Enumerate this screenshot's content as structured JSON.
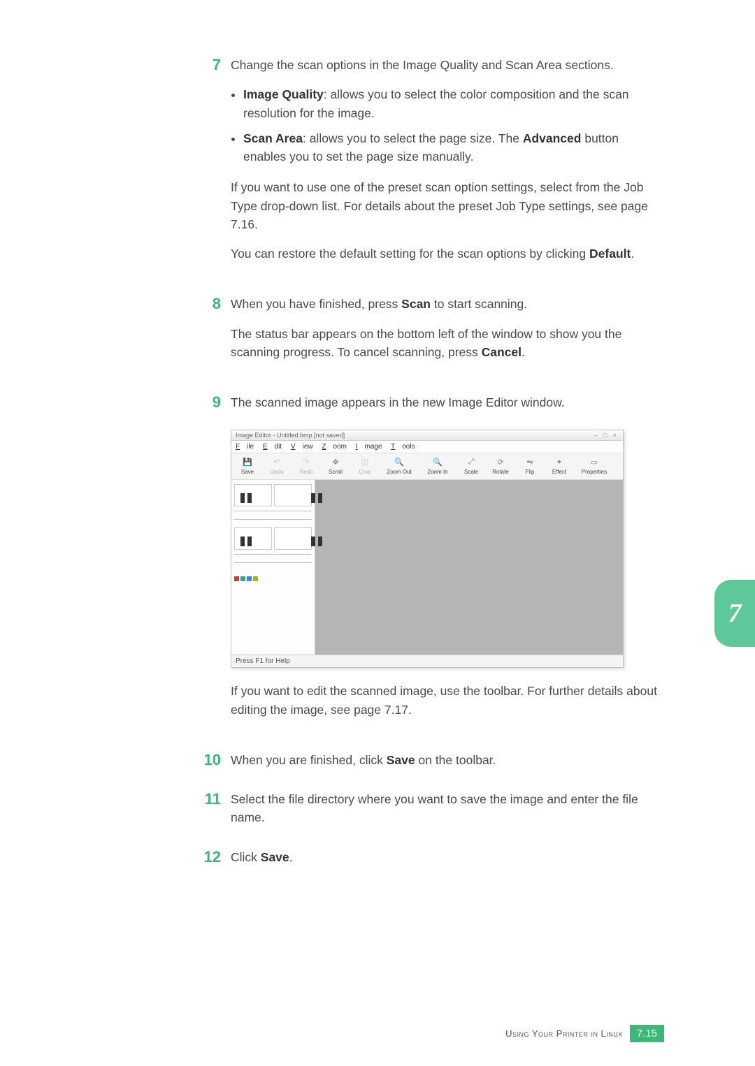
{
  "steps": {
    "s7": {
      "num": "7",
      "intro": "Change the scan options in the Image Quality and Scan Area sections.",
      "bullet1_label": "Image Quality",
      "bullet1_rest": ": allows you to select the color composition and the scan resolution for the image.",
      "bullet2_label": "Scan Area",
      "bullet2_rest_a": ": allows you to select the page size. The ",
      "bullet2_advanced": "Advanced",
      "bullet2_rest_b": " button enables you to set the page size manually.",
      "para1": "If you want to use one of the preset scan option settings, select from the Job Type drop-down list. For details about the preset Job Type settings, see page 7.16.",
      "para2_a": "You can restore the default setting for the scan options by clicking ",
      "para2_default": "Default",
      "para2_b": "."
    },
    "s8": {
      "num": "8",
      "line1_a": "When you have finished, press ",
      "line1_scan": "Scan",
      "line1_b": " to start scanning.",
      "line2_a": "The status bar appears on the bottom left of the window to show you the scanning progress. To cancel scanning, press ",
      "line2_cancel": "Cancel",
      "line2_b": "."
    },
    "s9": {
      "num": "9",
      "intro": "The scanned image appears in the new Image Editor window.",
      "after": "If you want to edit the scanned image, use the toolbar. For further details about editing the image, see page 7.17."
    },
    "s10": {
      "num": "10",
      "text_a": "When you are finished, click ",
      "text_save": "Save",
      "text_b": " on the toolbar."
    },
    "s11": {
      "num": "11",
      "text": "Select the file directory where you want to save the image and enter the file name."
    },
    "s12": {
      "num": "12",
      "text_a": "Click ",
      "text_save": "Save",
      "text_b": "."
    }
  },
  "editor": {
    "title": "Image Editor - Untitled.bmp [not saved]",
    "winctrl": "– □ ×",
    "menu": {
      "file": "File",
      "edit": "Edit",
      "view": "View",
      "zoom": "Zoom",
      "image": "Image",
      "tools": "Tools"
    },
    "toolbar": {
      "save": "Save",
      "undo": "Undo",
      "redo": "Redo",
      "scroll": "Scroll",
      "crop": "Crop",
      "zoomout": "Zoom Out",
      "zoomin": "Zoom In",
      "scale": "Scale",
      "rotate": "Rotate",
      "flip": "Flip",
      "effect": "Effect",
      "properties": "Properties"
    },
    "status": "Press F1 for Help"
  },
  "tab": "7",
  "footer": {
    "text": "Using Your Printer in Linux",
    "page": "7.15"
  }
}
